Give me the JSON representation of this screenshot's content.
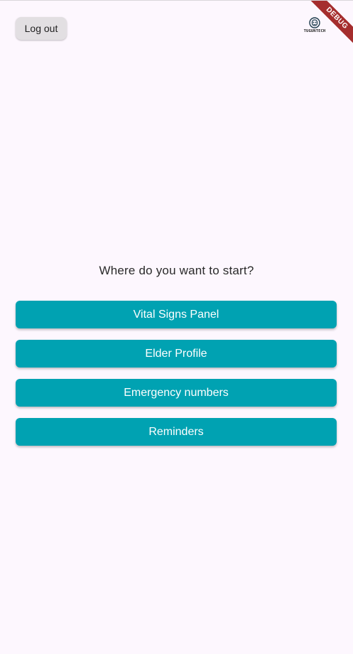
{
  "header": {
    "logout_label": "Log out",
    "logo_text": "TUGUNTECH",
    "debug_label": "DEBUG"
  },
  "main": {
    "prompt": "Where do you want to start?",
    "options": [
      {
        "label": "Vital Signs Panel"
      },
      {
        "label": "Elder Profile"
      },
      {
        "label": "Emergency numbers"
      },
      {
        "label": "Reminders"
      }
    ]
  },
  "colors": {
    "background": "#fdf7fe",
    "accent": "#00a2b2",
    "logout_button": "#e2dfe2",
    "debug_banner": "#a52d2d"
  },
  "icons": {
    "logo": "tuguntech-logo-icon"
  }
}
